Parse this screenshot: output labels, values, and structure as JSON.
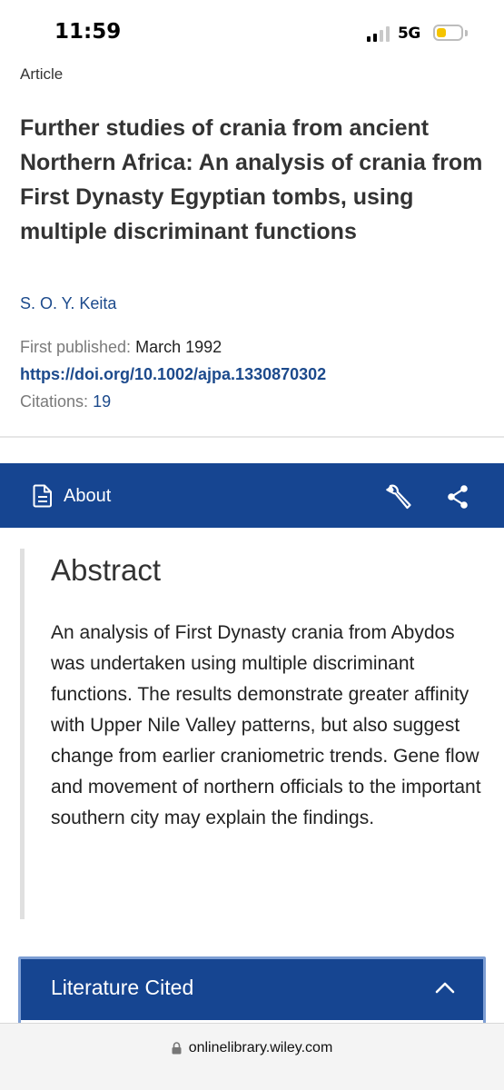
{
  "status_bar": {
    "time": "11:59",
    "network": "5G",
    "signal_bars_on": 2,
    "signal_bars_total": 4,
    "battery_level": 0.4,
    "battery_color": "#f5c400"
  },
  "article": {
    "type": "Article",
    "title": "Further studies of crania from ancient Northern Africa: An analysis of crania from First Dynasty Egyptian tombs, using multiple discriminant functions",
    "author": "S. O. Y. Keita",
    "first_published_label": "First published:",
    "first_published_value": "March 1992",
    "doi": "https://doi.org/10.1002/ajpa.1330870302",
    "citations_label": "Citations:",
    "citations_value": "19"
  },
  "toolbar": {
    "about_label": "About",
    "about_icon": "document-icon",
    "tools_icon": "wrench-icon",
    "share_icon": "share-icon",
    "background_color": "#164591"
  },
  "abstract": {
    "heading": "Abstract",
    "text": "An analysis of First Dynasty crania from Abydos was undertaken using multiple discriminant functions. The results demonstrate greater affinity with Upper Nile Valley patterns, but also suggest change from earlier craniometric trends. Gene flow and movement of northern officials to the important southern city may explain the findings."
  },
  "literature": {
    "label": "Literature Cited",
    "icon": "chevron-up-icon"
  },
  "browser": {
    "url": "onlinelibrary.wiley.com",
    "icon": "lock-icon"
  }
}
